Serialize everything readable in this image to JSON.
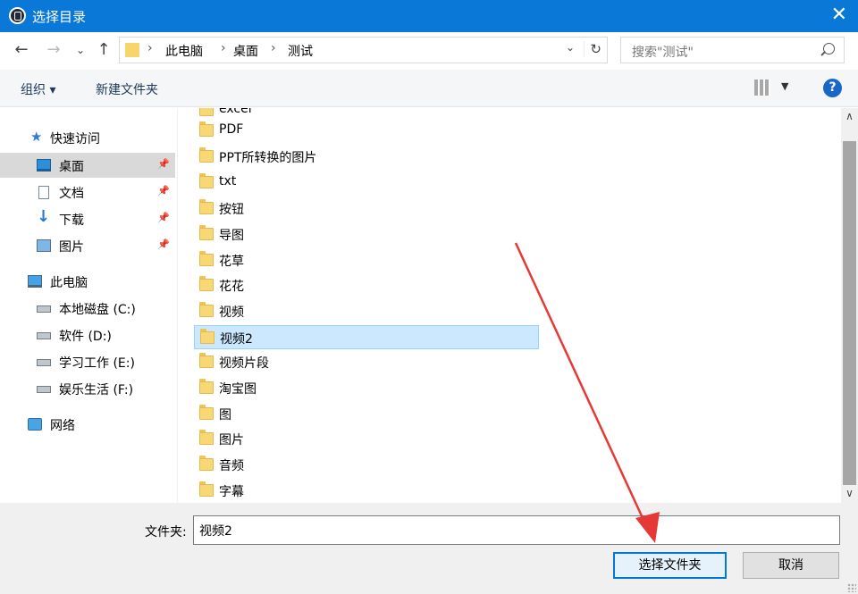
{
  "window": {
    "title": "选择目录"
  },
  "address": {
    "breadcrumbs": [
      "此电脑",
      "桌面",
      "测试"
    ],
    "search_placeholder": "搜索\"测试\""
  },
  "toolbar": {
    "organize": "组织 ▾",
    "new_folder": "新建文件夹"
  },
  "nav": {
    "quick_access": "快速访问",
    "desktop": "桌面",
    "documents": "文档",
    "downloads": "下载",
    "pictures": "图片",
    "this_pc": "此电脑",
    "drive_c": "本地磁盘 (C:)",
    "drive_d": "软件 (D:)",
    "drive_e": "学习工作 (E:)",
    "drive_f": "娱乐生活 (F:)",
    "network": "网络"
  },
  "files": [
    "excel",
    "PDF",
    "PPT所转换的图片",
    "txt",
    "按钮",
    "导图",
    "花草",
    "花花",
    "视频",
    "视频2",
    "视频片段",
    "淘宝图",
    "图",
    "图片",
    "音频",
    "字幕"
  ],
  "selected_file": "视频2",
  "bottom": {
    "folder_label": "文件夹:",
    "folder_value": "视频2",
    "select_button": "选择文件夹",
    "cancel_button": "取消"
  },
  "annotation": {
    "arrow_color": "#e53935"
  }
}
